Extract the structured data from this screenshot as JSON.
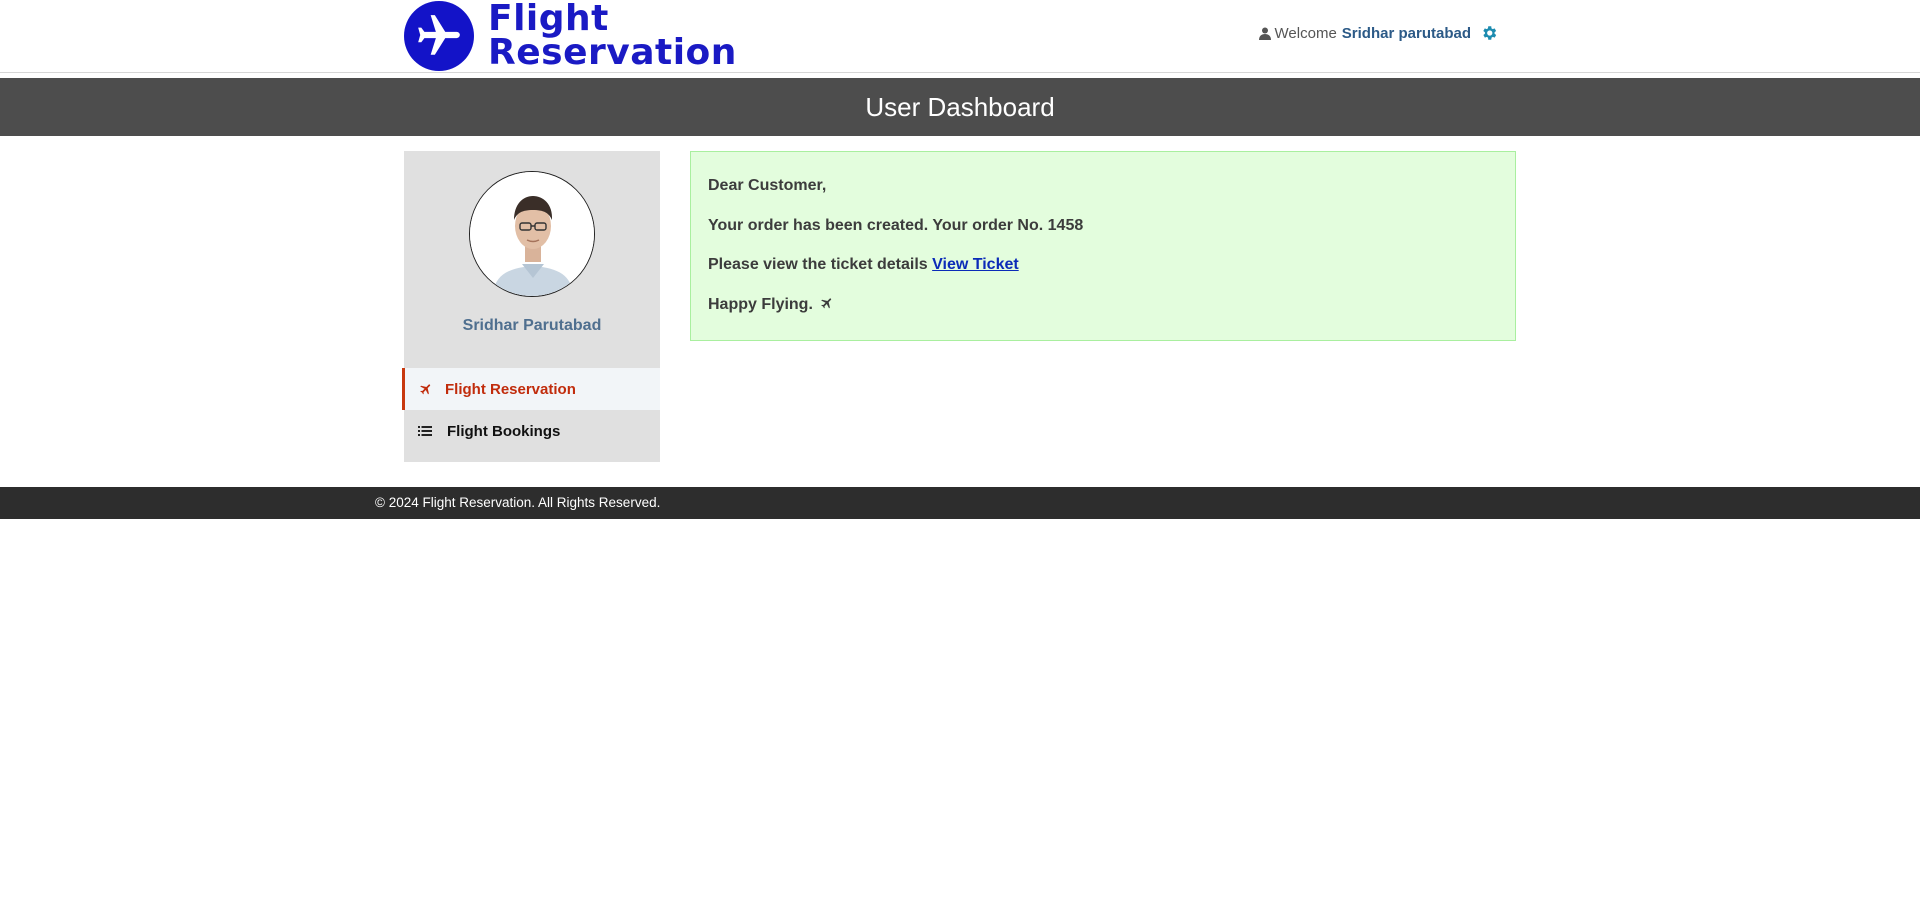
{
  "header": {
    "logo": {
      "line1": "Flight",
      "line2": "Reservation"
    },
    "welcome_label": "Welcome",
    "user_name": "Sridhar parutabad"
  },
  "title_bar": {
    "title": "User Dashboard"
  },
  "sidebar": {
    "profile_name": "Sridhar Parutabad",
    "items": [
      {
        "label": "Flight Reservation",
        "icon": "plane-icon",
        "active": true
      },
      {
        "label": "Flight Bookings",
        "icon": "list-icon",
        "active": false
      }
    ]
  },
  "message": {
    "greeting": "Dear Customer,",
    "order_text": "Your order has been created. Your order No. 1458",
    "ticket_text": "Please view the ticket details",
    "ticket_link": "View Ticket",
    "closing": "Happy Flying."
  },
  "footer": {
    "text": "© 2024 Flight Reservation. All Rights Reserved."
  },
  "colors": {
    "brand_blue": "#1313c8",
    "title_bar": "#4d4d4d",
    "active_nav": "#c12c0c",
    "success_bg": "#e3fddd",
    "footer_bg": "#2d2d2d"
  }
}
